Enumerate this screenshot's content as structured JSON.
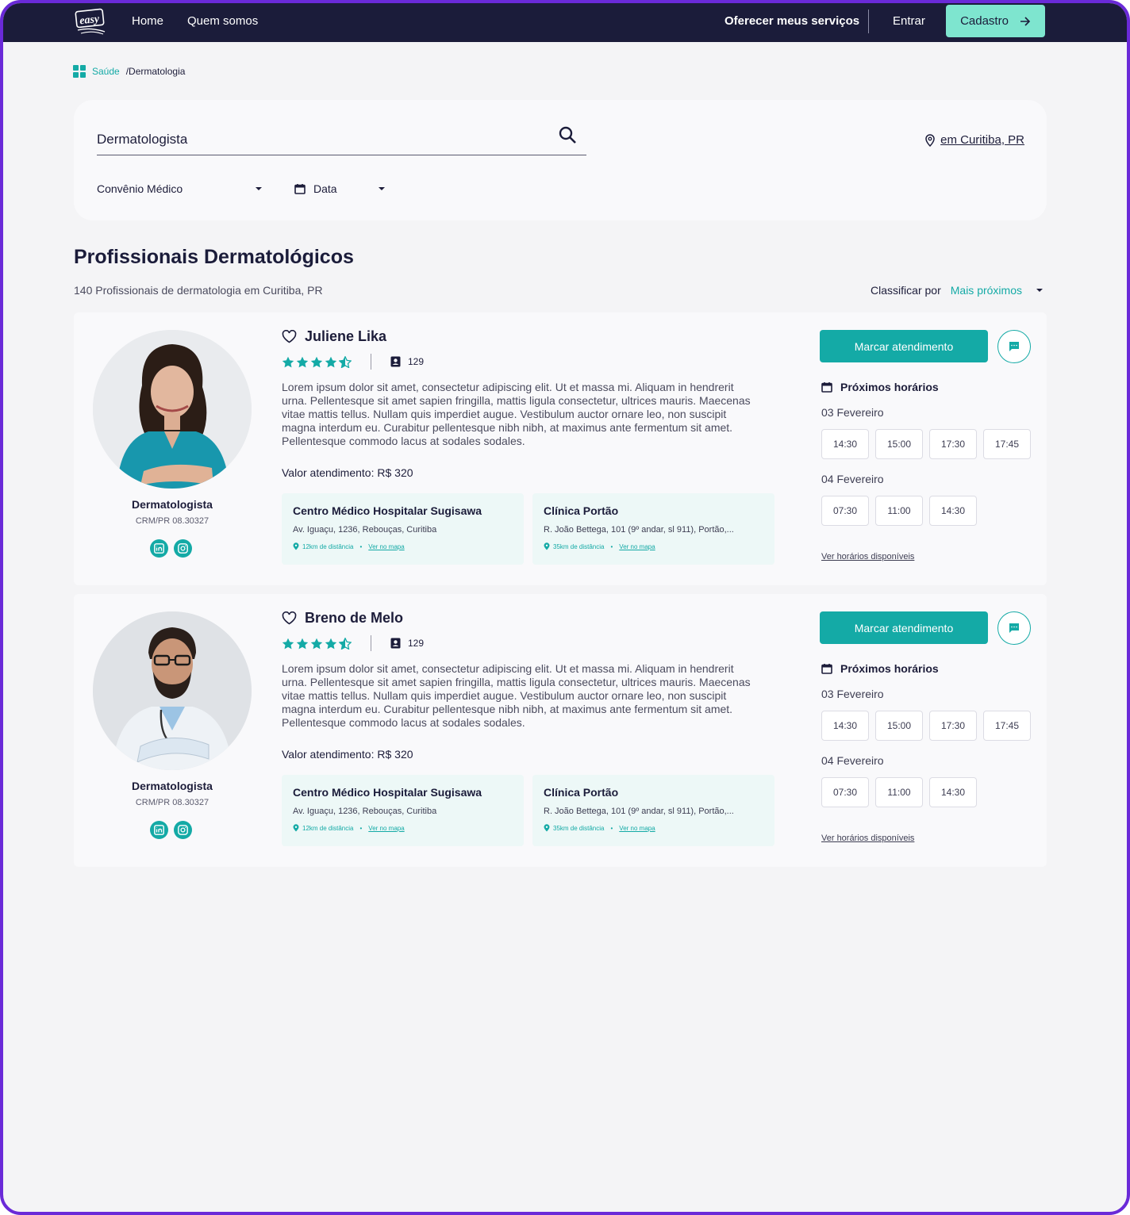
{
  "topbar": {
    "logo_text": "easy",
    "nav": [
      "Home",
      "Quem somos"
    ],
    "offer": "Oferecer meus serviços",
    "login": "Entrar",
    "signup": "Cadastro"
  },
  "breadcrumb": {
    "root": "Saúde",
    "current": "/Dermatologia"
  },
  "search": {
    "query": "Dermatologista",
    "location": "em Curitiba, PR",
    "filter_insurance": "Convênio Médico",
    "filter_date": "Data"
  },
  "results": {
    "title": "Profissionais Dermatológicos",
    "subtitle": "140 Profissionais de dermatologia em Curitiba, PR",
    "sort_label": "Classificar por",
    "sort_value": "Mais próximos"
  },
  "colors": {
    "accent": "#14aaa6",
    "navbar": "#1b1c3a",
    "signup": "#7ee5cf"
  },
  "professionals": [
    {
      "name": "Juliene Lika",
      "rating": 4.5,
      "reviews": "129",
      "description": "Lorem ipsum dolor sit amet, consectetur adipiscing elit. Ut et massa mi. Aliquam in hendrerit urna. Pellentesque sit amet sapien fringilla, mattis ligula consectetur, ultrices mauris. Maecenas vitae mattis tellus. Nullam quis imperdiet augue. Vestibulum auctor ornare leo, non suscipit magna interdum eu. Curabitur pellentesque nibh nibh, at maximus ante fermentum sit amet. Pellentesque commodo lacus at sodales sodales.",
      "price": "Valor atendimento: R$ 320",
      "specialty": "Dermatologista",
      "crm": "CRM/PR 08.30327",
      "book_label": "Marcar atendimento",
      "next_label": "Próximos horários",
      "day1": "03 Fevereiro",
      "slots1": [
        "14:30",
        "15:00",
        "17:30",
        "17:45"
      ],
      "day2": "04 Fevereiro",
      "slots2": [
        "07:30",
        "11:00",
        "14:30"
      ],
      "more_label": "Ver horários disponíveis",
      "clinics": [
        {
          "name": "Centro Médico Hospitalar Sugisawa",
          "address": "Av. Iguaçu, 1236, Rebouças, Curitiba",
          "distance": "12km de distância",
          "map": "Ver no mapa"
        },
        {
          "name": "Clínica Portão",
          "address": "R. João Bettega, 101  (9º andar, sl 911), Portão,...",
          "distance": "35km de distância",
          "map": "Ver no mapa"
        }
      ]
    },
    {
      "name": "Breno de Melo",
      "rating": 4.5,
      "reviews": "129",
      "description": "Lorem ipsum dolor sit amet, consectetur adipiscing elit. Ut et massa mi. Aliquam in hendrerit urna. Pellentesque sit amet sapien fringilla, mattis ligula consectetur, ultrices mauris. Maecenas vitae mattis tellus. Nullam quis imperdiet augue. Vestibulum auctor ornare leo, non suscipit magna interdum eu. Curabitur pellentesque nibh nibh, at maximus ante fermentum sit amet. Pellentesque commodo lacus at sodales sodales.",
      "price": "Valor atendimento: R$ 320",
      "specialty": "Dermatologista",
      "crm": "CRM/PR 08.30327",
      "book_label": "Marcar atendimento",
      "next_label": "Próximos horários",
      "day1": "03 Fevereiro",
      "slots1": [
        "14:30",
        "15:00",
        "17:30",
        "17:45"
      ],
      "day2": "04 Fevereiro",
      "slots2": [
        "07:30",
        "11:00",
        "14:30"
      ],
      "more_label": "Ver horários disponíveis",
      "clinics": [
        {
          "name": "Centro Médico Hospitalar Sugisawa",
          "address": "Av. Iguaçu, 1236, Rebouças, Curitiba",
          "distance": "12km de distância",
          "map": "Ver no mapa"
        },
        {
          "name": "Clínica Portão",
          "address": "R. João Bettega, 101  (9º andar, sl 911), Portão,...",
          "distance": "35km de distância",
          "map": "Ver no mapa"
        }
      ]
    }
  ]
}
